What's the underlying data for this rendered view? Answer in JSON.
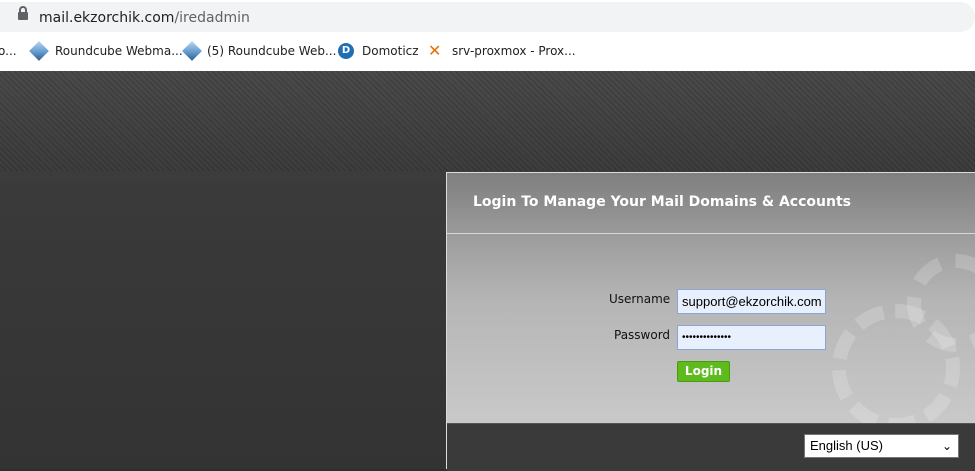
{
  "browser": {
    "url_host": "mail.ekzorchik.com",
    "url_path": "/iredadmin",
    "bookmarks": [
      {
        "label": "o...",
        "icon": "generic-icon"
      },
      {
        "label": "Roundcube Webma...",
        "icon": "roundcube-icon"
      },
      {
        "label": "(5) Roundcube Web...",
        "icon": "roundcube-icon"
      },
      {
        "label": "Domoticz",
        "icon": "domoticz-icon"
      },
      {
        "label": "srv-proxmox - Prox...",
        "icon": "proxmox-icon"
      }
    ]
  },
  "login": {
    "title": "Login To Manage Your Mail Domains & Accounts",
    "username_label": "Username",
    "username_value": "support@ekzorchik.com",
    "password_label": "Password",
    "password_value": "••••••••••••••",
    "login_button": "Login",
    "language_selected": "English (US)"
  },
  "colors": {
    "login_button": "#5fba1e",
    "background": "#2f2f2f"
  }
}
